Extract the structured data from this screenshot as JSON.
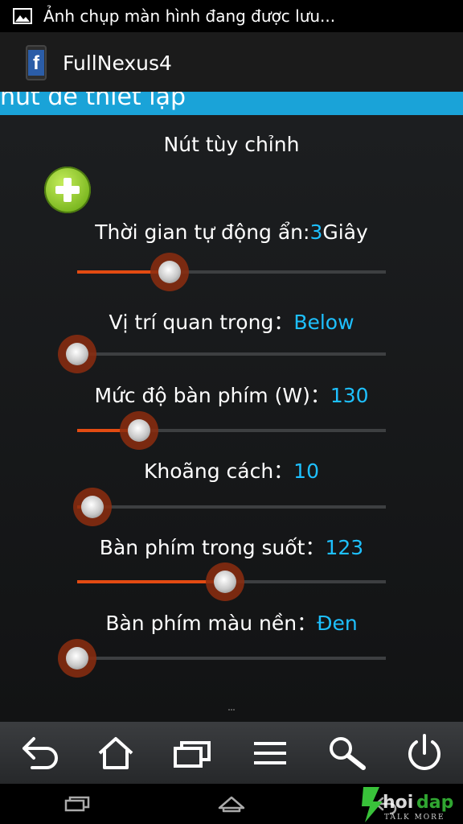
{
  "status_bar": {
    "notification_text": "Ảnh chụp màn hình đang được lưu...",
    "icon": "image-icon"
  },
  "action_bar": {
    "app_title": "FullNexus4",
    "app_icon_letter": "f",
    "icon": "facebook-icon"
  },
  "section_header": {
    "title": "nút để thiết lập"
  },
  "custom_buttons": {
    "title": "Nút tùy chỉnh",
    "add_icon": "add-circle-icon"
  },
  "settings": [
    {
      "label": "Thời gian tự động ẩn:",
      "value": "3",
      "suffix": "Giây",
      "fraction": 0.3
    },
    {
      "label": "Vị trí quan trọng：",
      "value": "Below",
      "suffix": "",
      "fraction": 0.0
    },
    {
      "label": "Mức độ bàn phím (W)：",
      "value": "130",
      "suffix": "",
      "fraction": 0.2
    },
    {
      "label": "Khoãng cách：",
      "value": "10",
      "suffix": "",
      "fraction": 0.05
    },
    {
      "label": "Bàn phím trong suốt：",
      "value": "123",
      "suffix": "",
      "fraction": 0.48
    },
    {
      "label": "Bàn phím màu nền：",
      "value": "Đen",
      "suffix": "",
      "fraction": 0.0
    }
  ],
  "keyboard_bar": {
    "buttons": [
      "back-arrow-icon",
      "home-icon",
      "recent-apps-icon",
      "menu-icon",
      "search-icon",
      "power-icon"
    ]
  },
  "system_nav": {
    "buttons": [
      "recent-apps-icon",
      "home-icon",
      "back-icon"
    ]
  },
  "colors": {
    "accent": "#1aa3d8",
    "value_text": "#1ec0ff",
    "slider_fill": "#e34b12",
    "add_button": "#7cb821"
  }
}
